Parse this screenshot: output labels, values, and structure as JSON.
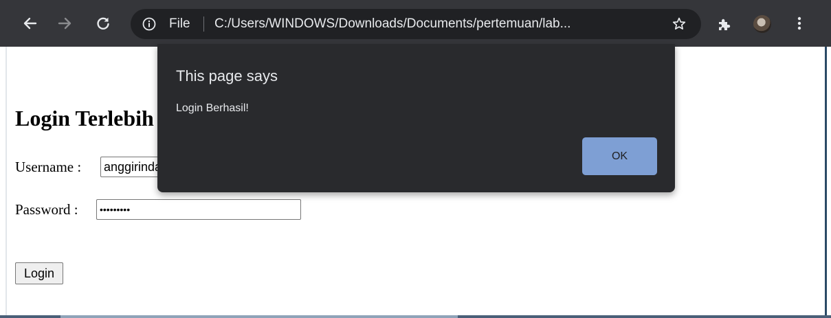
{
  "browser": {
    "omnibox": {
      "scheme_label": "File",
      "url": "C:/Users/WINDOWS/Downloads/Documents/pertemuan/lab..."
    },
    "icons": {
      "back": "back-arrow-icon",
      "forward": "forward-arrow-icon",
      "reload": "reload-icon",
      "info": "info-icon",
      "bookmark": "star-icon",
      "extensions": "puzzle-piece-icon",
      "profile": "profile-avatar",
      "menu": "kebab-menu-icon"
    },
    "colors": {
      "toolbar_bg": "#35363a",
      "omnibox_bg": "#202124",
      "text": "#e8eaed"
    }
  },
  "page": {
    "heading": "Login Terlebih Dahulu",
    "username": {
      "label": "Username :",
      "value": "anggirinda"
    },
    "password": {
      "label": "Password :",
      "masked_value": "•••••••••"
    },
    "login_button": "Login"
  },
  "dialog": {
    "title": "This page says",
    "message": "Login Berhasil!",
    "ok_label": "OK",
    "colors": {
      "background": "#292a2d",
      "ok_button": "#7e9fd4"
    }
  }
}
